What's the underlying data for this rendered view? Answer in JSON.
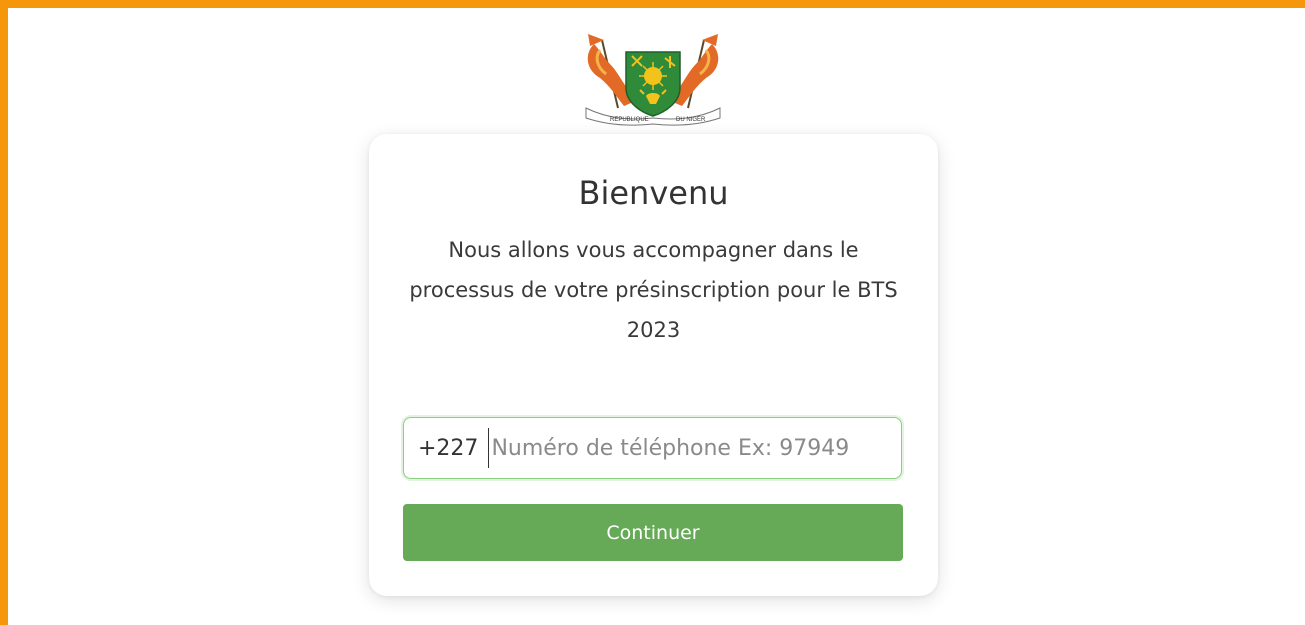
{
  "header": {
    "emblem_icon": "niger-coat-of-arms-icon",
    "emblem_text_left": "REPUBLIQUE",
    "emblem_text_right": "DU NIGER"
  },
  "card": {
    "title": "Bienvenu",
    "intro": "Nous allons vous accompagner dans le processus de votre présinscription pour le BTS 2023"
  },
  "phone": {
    "prefix": "+227",
    "value": "",
    "placeholder": "Numéro de téléphone Ex: 97949"
  },
  "actions": {
    "continue_label": "Continuer"
  },
  "colors": {
    "border": "#f5960b",
    "button": "#66aa57",
    "input_focus": "#8ccf83"
  }
}
